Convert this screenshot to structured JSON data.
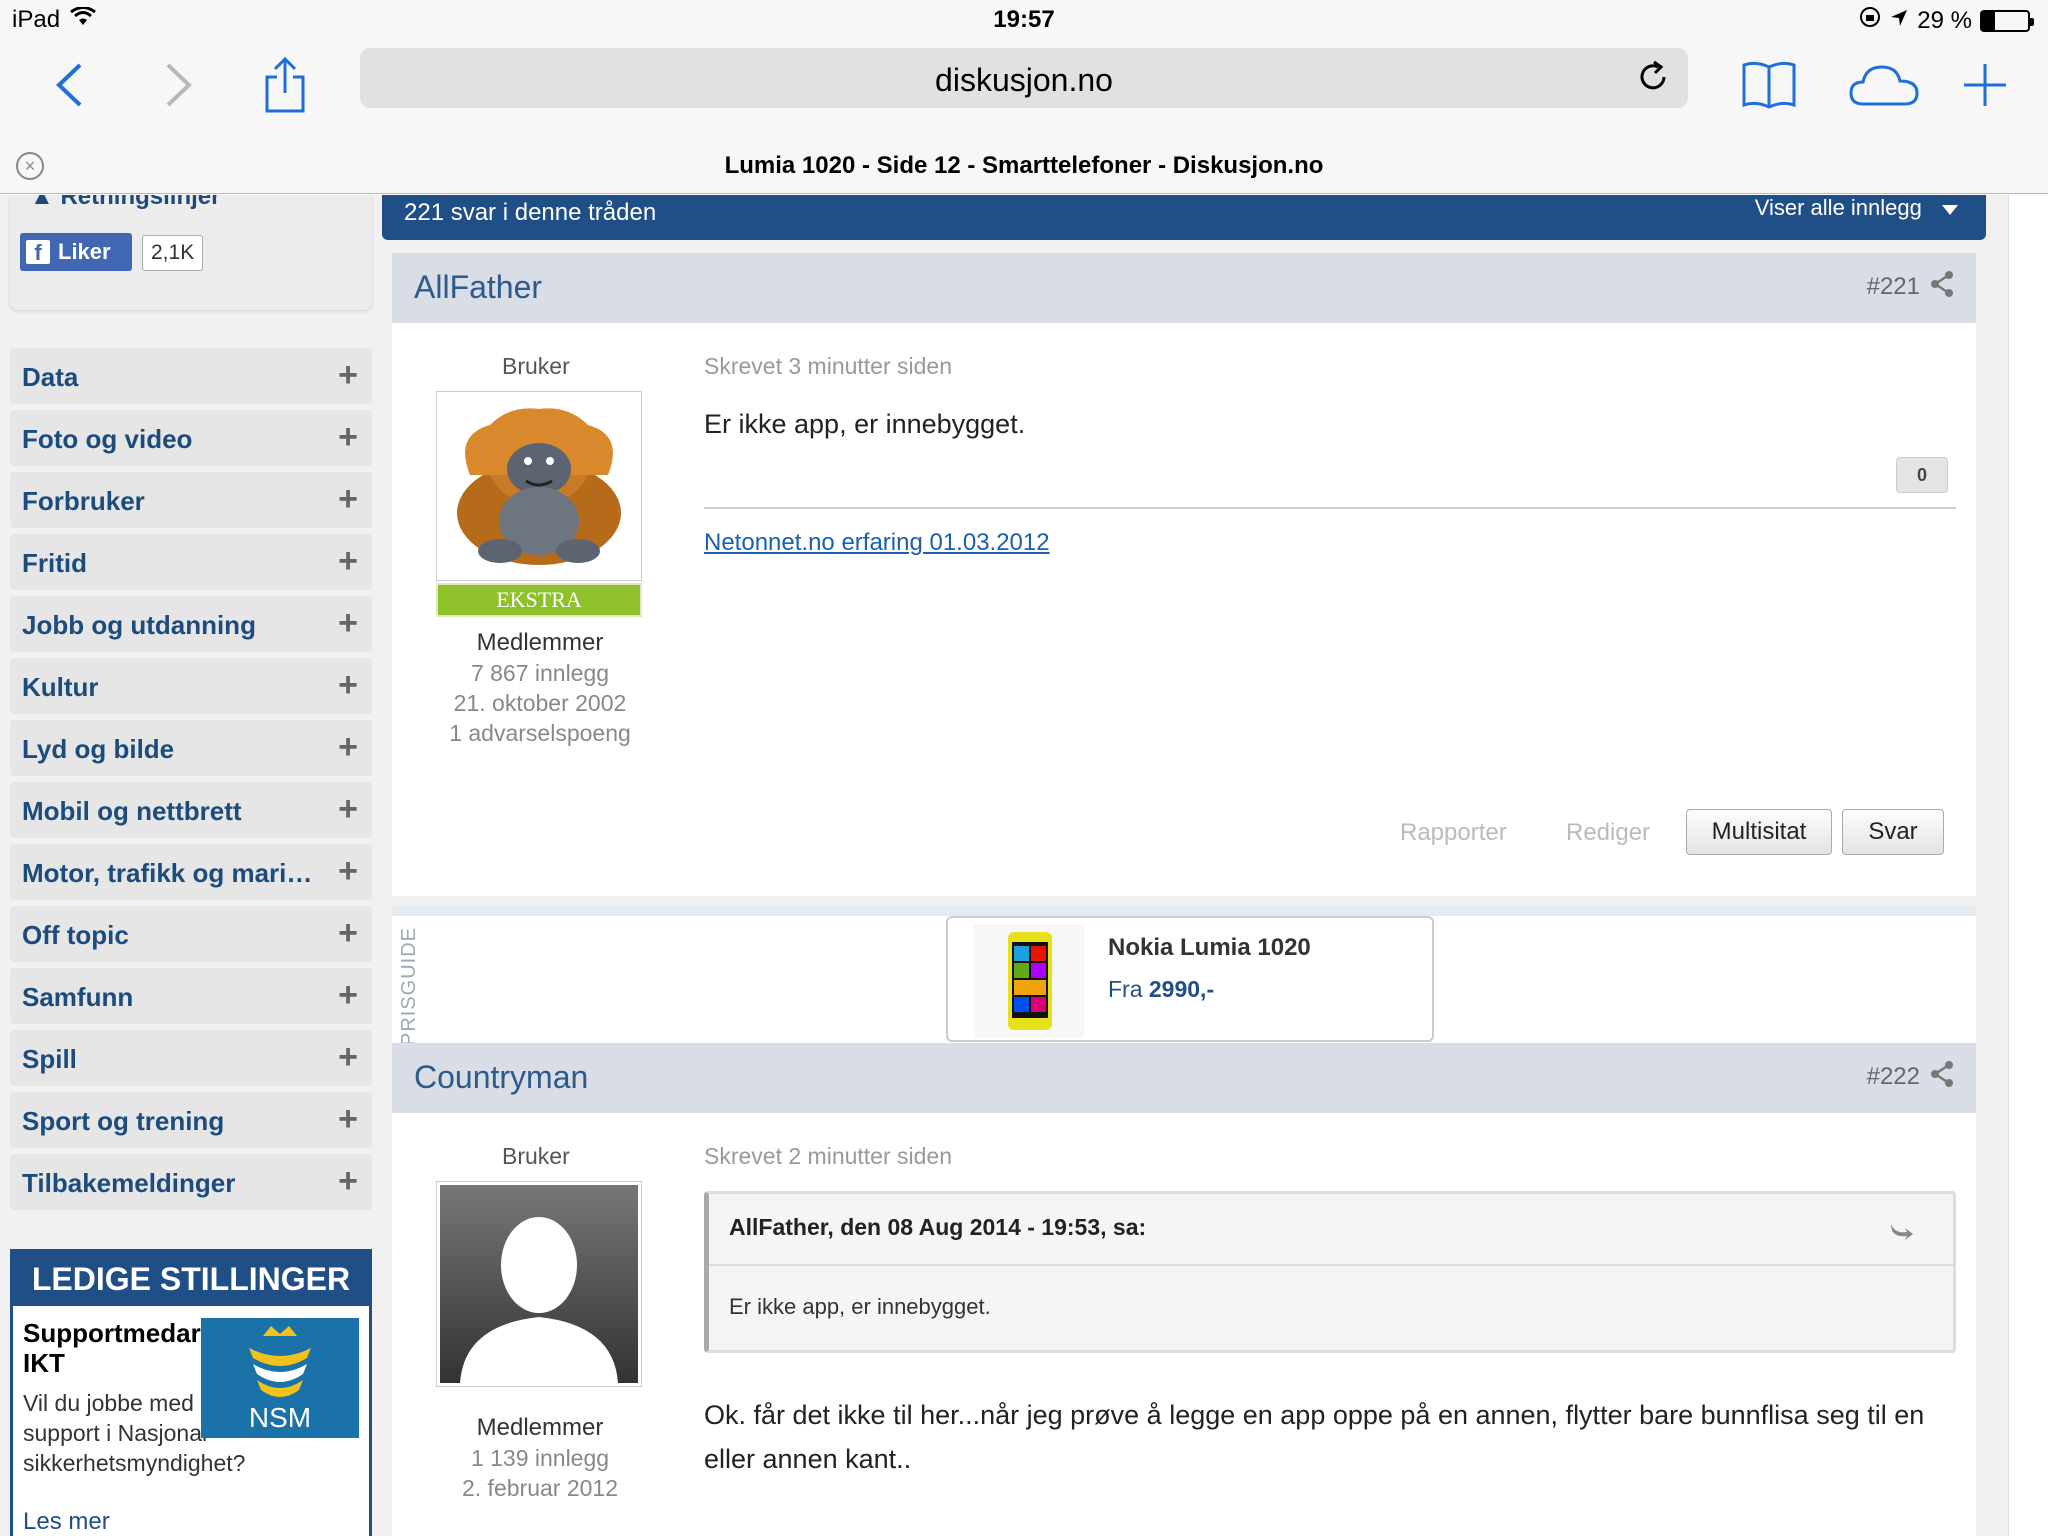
{
  "status_bar": {
    "device": "iPad",
    "time": "19:57",
    "battery_text": "29 %",
    "battery_level": 0.29
  },
  "browser": {
    "url": "diskusjon.no",
    "tab_title": "Lumia 1020 - Side 12 - Smarttelefoner - Diskusjon.no",
    "icons": [
      "back-icon",
      "forward-icon",
      "share-icon",
      "reload-icon",
      "bookmarks-icon",
      "icloud-tabs-icon",
      "new-tab-icon",
      "close-tab-icon"
    ]
  },
  "sidebar": {
    "guidelines_label": "Retningslinjer",
    "fb_like_label": "Liker",
    "fb_like_count": "2,1K",
    "categories": [
      {
        "label": "Data"
      },
      {
        "label": "Foto og video"
      },
      {
        "label": "Forbruker"
      },
      {
        "label": "Fritid"
      },
      {
        "label": "Jobb og utdanning"
      },
      {
        "label": "Kultur"
      },
      {
        "label": "Lyd og bilde"
      },
      {
        "label": "Mobil og nettbrett"
      },
      {
        "label": "Motor, trafikk og mari…"
      },
      {
        "label": "Off topic"
      },
      {
        "label": "Samfunn"
      },
      {
        "label": "Spill"
      },
      {
        "label": "Sport og trening"
      },
      {
        "label": "Tilbakemeldinger"
      }
    ],
    "jobs": {
      "header": "LEDIGE STILLINGER",
      "title": "Supportmedarbeider IKT",
      "text": "Vil du jobbe med IT-support i Nasjonal sikkerhetsmyndighet?",
      "logo_text": "NSM",
      "more": "Les mer"
    }
  },
  "thread": {
    "reply_count": "221 svar i denne tråden",
    "filter_label": "Viser alle innlegg"
  },
  "posts": [
    {
      "author": "AllFather",
      "number": "#221",
      "role": "Bruker",
      "badge": "EKSTRA",
      "group": "Medlemmer",
      "post_count": "7 867 innlegg",
      "joined": "21. oktober 2002",
      "warnings": "1 advarselspoeng",
      "posted": "Skrevet 3 minutter siden",
      "content": "Er ikke app, er innebygget.",
      "rating": "0",
      "signature": "Netonnet.no erfaring 01.03.2012",
      "actions": {
        "report": "Rapporter",
        "edit": "Rediger",
        "multiquote": "Multisitat",
        "reply": "Svar"
      }
    },
    {
      "author": "Countryman",
      "number": "#222",
      "role": "Bruker",
      "group": "Medlemmer",
      "post_count": "1 139 innlegg",
      "joined": "2. februar 2012",
      "posted": "Skrevet 2 minutter siden",
      "quote_author": "AllFather, den 08 Aug 2014 - 19:53, sa:",
      "quote_text": "Er ikke app, er innebygget.",
      "content": "Ok. får det ikke til her...når jeg prøve å legge en app oppe på en annen, flytter bare bunnflisa seg til en eller annen kant.."
    }
  ],
  "prisguide": {
    "label": "PRISGUIDE",
    "product": "Nokia Lumia 1020",
    "price_prefix": "Fra",
    "price": "2990,-"
  },
  "colors": {
    "brand_blue": "#1f4f86",
    "link_blue": "#1a5fb4",
    "badge_green": "#8ec12a",
    "post_header_bg": "#d8dde6"
  }
}
